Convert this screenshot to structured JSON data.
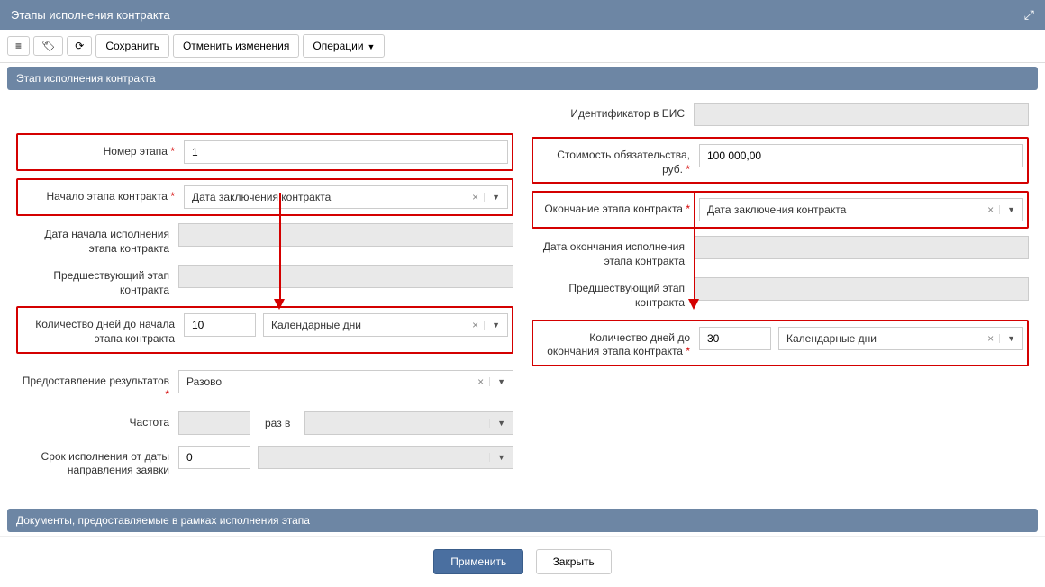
{
  "title": "Этапы исполнения контракта",
  "toolbar": {
    "save": "Сохранить",
    "cancel_changes": "Отменить изменения",
    "operations": "Операции"
  },
  "section1": "Этап исполнения контракта",
  "section2": "Документы, предоставляемые в рамках исполнения этапа",
  "left": {
    "stage_number_label": "Номер этапа",
    "stage_number_value": "1",
    "start_label": "Начало этапа контракта",
    "start_value": "Дата заключения контракта",
    "start_date_label": "Дата начала исполнения этапа контракта",
    "prev_stage_label": "Предшествующий этап контракта",
    "days_to_start_label": "Количество дней до начала этапа контракта",
    "days_to_start_value": "10",
    "days_type_value": "Календарные дни",
    "results_label": "Предоставление результатов",
    "results_value": "Разово",
    "frequency_label": "Частота",
    "frequency_mid": "раз в",
    "deadline_label": "Срок исполнения от даты направления заявки",
    "deadline_value": "0"
  },
  "right": {
    "eis_id_label": "Идентификатор в ЕИС",
    "cost_label": "Стоимость обязательства, руб.",
    "cost_value": "100 000,00",
    "end_label": "Окончание этапа контракта",
    "end_value": "Дата заключения контракта",
    "end_date_label": "Дата окончания исполнения этапа контракта",
    "prev_stage_label": "Предшествующий этап контракта",
    "days_to_end_label": "Количество дней до окончания этапа контракта",
    "days_to_end_value": "30",
    "days_type_value": "Календарные дни"
  },
  "footer": {
    "apply": "Применить",
    "close": "Закрыть"
  }
}
